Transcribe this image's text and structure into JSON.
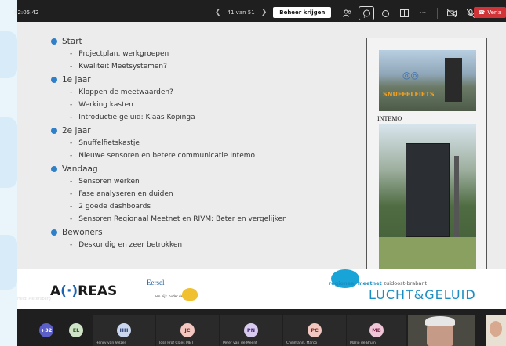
{
  "toolbar": {
    "clock": "02:05:42",
    "page_indicator": "41 van 51",
    "take_control_label": "Beheer krijgen",
    "leave_label": "Verla",
    "icons": [
      "prev-arrow-icon",
      "next-arrow-icon",
      "people-icon",
      "chat-icon",
      "reactions-icon",
      "rooms-icon",
      "more-icon",
      "camera-off-icon",
      "mic-off-icon",
      "share-icon",
      "phone-icon"
    ]
  },
  "slide": {
    "sections": [
      {
        "title": "Start",
        "items": [
          "Projectplan, werkgroepen",
          "Kwaliteit Meetsystemen?"
        ]
      },
      {
        "title": "1e jaar",
        "items": [
          "Kloppen de meetwaarden?",
          "Werking kasten",
          "Introductie geluid: Klaas Kopinga"
        ]
      },
      {
        "title": "2e jaar",
        "items": [
          "Snuffelfietskastje",
          "Nieuwe sensoren en betere communicatie Intemo"
        ]
      },
      {
        "title": "Vandaag",
        "items": [
          "Sensoren werken",
          "Fase analyseren en duiden",
          "2 goede dashboards",
          "Sensoren Regionaal Meetnet en RIVM:  Beter en vergelijken"
        ]
      },
      {
        "title": "Bewoners",
        "items": [
          "Deskundig en zeer betrokken"
        ]
      }
    ],
    "photo_caption": "INTEMO",
    "snuffel_brand_a": "SNUFFEL",
    "snuffel_brand_b": "FIETS",
    "logos": {
      "aireas_left": "A",
      "aireas_mid": "(·)",
      "aireas_right": "REAS",
      "eersel_name": "Eersel",
      "eersel_small": "een bijz. ouder de jaar",
      "meetnet_a": "regionaal meetnet",
      "meetnet_b": " zuidoost-brabant",
      "lucht_geluid": "LUCHT&GELUID"
    }
  },
  "presenter_label": "Heidi Pietersberg",
  "participants": {
    "overflow": "+32",
    "tiles": [
      {
        "initials": "EL",
        "name": ""
      },
      {
        "initials": "HH",
        "name": "Henry van Velzen"
      },
      {
        "initials": "JC",
        "name": "Joss Prof Claes MBT"
      },
      {
        "initials": "PN",
        "name": "Peter van de Meent"
      },
      {
        "initials": "PC",
        "name": "Chilimann, Marco"
      },
      {
        "initials": "MB",
        "name": "Mario de Bruin"
      }
    ]
  },
  "colors": {
    "accent_blue": "#2f80c9",
    "leave_red": "#d13438",
    "avatar_el": "#cfe3c6",
    "avatar_hh": "#c9d6ee",
    "avatar_jc": "#f2c7c1",
    "avatar_pn": "#d8c9ee",
    "avatar_pc": "#f2c7c1",
    "avatar_mb": "#f1c5d8"
  }
}
